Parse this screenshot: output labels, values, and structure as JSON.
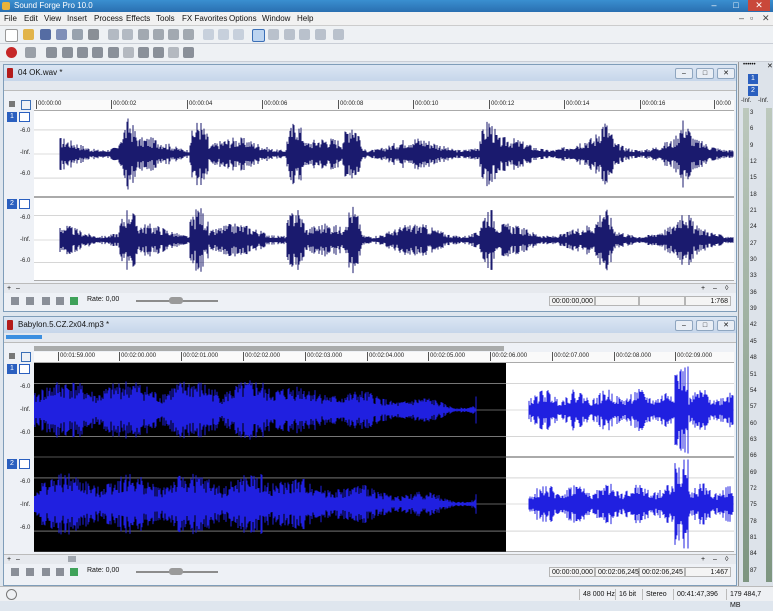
{
  "app": {
    "title": "Sound Forge Pro 10.0"
  },
  "menu": [
    "File",
    "Edit",
    "View",
    "Insert",
    "Process",
    "Effects",
    "Tools",
    "FX Favorites",
    "Options",
    "Window",
    "Help"
  ],
  "windows": [
    {
      "name": "04 OK.wav *",
      "ruler": [
        "00:00:00",
        "00:00:02",
        "00:00:04",
        "00:00:06",
        "00:00:08",
        "00:00:10",
        "00:00:12",
        "00:00:14",
        "00:00:16",
        "00:00"
      ],
      "channels": [
        "1",
        "2"
      ],
      "db_labels": [
        "-6.0",
        "-Inf.",
        "-6.0"
      ],
      "rate_label": "Rate: 0,00",
      "position": "00:00:00,000",
      "zoom": "1:768"
    },
    {
      "name": "Babylon.5.CZ.2x04.mp3 *",
      "ruler": [
        "00:01:59.000",
        "00:02:00.000",
        "00:02:01.000",
        "00:02:02.000",
        "00:02:03.000",
        "00:02:04.000",
        "00:02:05.000",
        "00:02:06.000",
        "00:02:07.000",
        "00:02:08.000",
        "00:02:09.000"
      ],
      "channels": [
        "1",
        "2"
      ],
      "db_labels": [
        "-6.0",
        "-Inf.",
        "-6.0"
      ],
      "rate_label": "Rate: 0,00",
      "position": "00:00:00,000",
      "sel_start": "00:02:06,245",
      "sel_end": "00:02:06,245",
      "zoom": "1:467"
    }
  ],
  "status": {
    "sample_rate": "48 000 Hz",
    "bit_depth": "16 bit",
    "channels": "Stereo",
    "length": "00:41:47,396",
    "disk": "179 484,7 MB"
  },
  "meters": {
    "channels": [
      "1",
      "2"
    ],
    "labels": [
      "-Inf.",
      "-Inf."
    ],
    "scale": [
      "3",
      "6",
      "9",
      "12",
      "15",
      "18",
      "21",
      "24",
      "27",
      "30",
      "33",
      "36",
      "39",
      "42",
      "45",
      "48",
      "51",
      "54",
      "57",
      "60",
      "63",
      "66",
      "69",
      "72",
      "75",
      "78",
      "81",
      "84",
      "87"
    ]
  },
  "colors": {
    "waveform": "#1a1a6e",
    "selected_waveform": "#2020e0",
    "selection_bg": "#000000",
    "title": "#2a6fb0"
  }
}
